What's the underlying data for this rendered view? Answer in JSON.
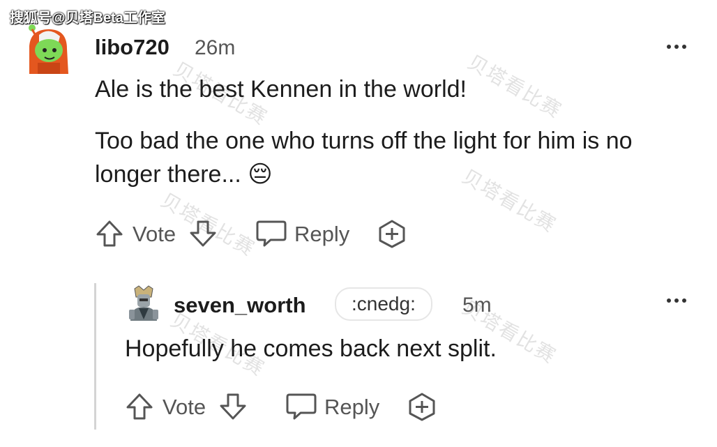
{
  "watermark": {
    "top_left": "搜狐号@贝塔Beta工作室",
    "overlay": "贝塔看比赛"
  },
  "comment": {
    "username": "libo720",
    "timestamp": "26m",
    "paragraphs": [
      "Ale is the best Kennen in the world!",
      "Too bad the one who turns off the light for him is no longer there... 😔"
    ],
    "actions": {
      "upvote_icon": "arrow-up-icon",
      "vote_label": "Vote",
      "downvote_icon": "arrow-down-icon",
      "reply_icon": "speech-bubble-icon",
      "reply_label": "Reply",
      "award_icon": "plus-circle-icon"
    }
  },
  "reply": {
    "username": "seven_worth",
    "flair": ":cnedg:",
    "timestamp": "5m",
    "text": "Hopefully he comes back next split.",
    "actions": {
      "vote_label": "Vote",
      "reply_label": "Reply"
    }
  },
  "colors": {
    "text": "#1c1c1c",
    "muted": "#555555",
    "avatar_orange": "#e4571f",
    "avatar_green": "#7ed957",
    "thread_line": "#d4d4d4"
  }
}
